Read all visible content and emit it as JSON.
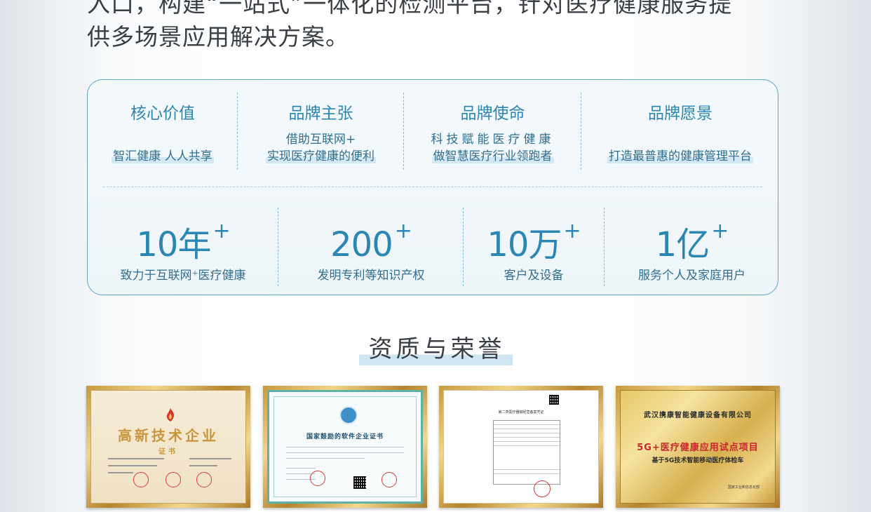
{
  "intro": {
    "line1": "入口，构建“一站式”一体化的检测平台，针对医疗健康服务提",
    "line2": "供多场景应用解决方案。"
  },
  "values": [
    {
      "title": "核心价值",
      "lines": [
        "智汇健康 人人共享"
      ]
    },
    {
      "title": "品牌主张",
      "lines": [
        "借助互联网+",
        "实现医疗健康的便利"
      ]
    },
    {
      "title": "品牌使命",
      "lines": [
        "科技赋能医疗健康",
        "做智慧医疗行业领跑者"
      ]
    },
    {
      "title": "品牌愿景",
      "lines": [
        "打造最普惠的健康管理平台"
      ]
    }
  ],
  "stats": [
    {
      "number": "10年",
      "plus": "+",
      "label": "致力于互联网⁺医疗健康"
    },
    {
      "number": "200",
      "plus": "+",
      "label": "发明专利等知识产权"
    },
    {
      "number": "10万",
      "plus": "+",
      "label": "客户及设备"
    },
    {
      "number": "1亿",
      "plus": "+",
      "label": "服务个人及家庭用户"
    }
  ],
  "section_title": "资质与荣誉",
  "certificates": [
    {
      "title": "高新技术企业",
      "subtitle": "证书"
    },
    {
      "title": "国家鼓励的软件企业证书"
    },
    {
      "title": "第二类医疗器械经营备案凭证"
    },
    {
      "company": "武汉携康智能健康设备有限公司",
      "project": "5G+医疗健康应用试点项目",
      "desc": "基于5G技术智能移动医疗体检车",
      "issuer": "国家工业和信息化部"
    }
  ]
}
